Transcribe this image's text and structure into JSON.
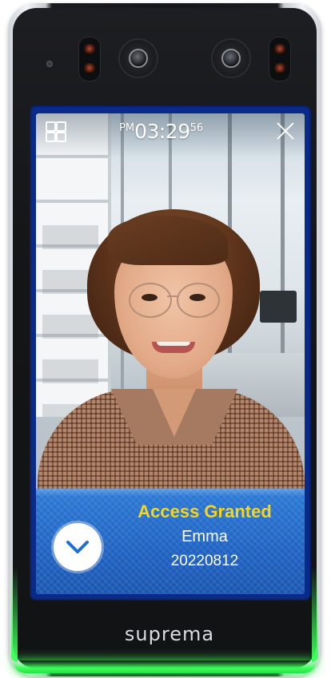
{
  "device": {
    "brand": "suprema",
    "led_color": "#3cff58",
    "frame_color": "#0a2a8a"
  },
  "status_bar": {
    "ampm": "PM",
    "time": "03:29",
    "seconds": "56",
    "menu_icon": "grid-menu-icon",
    "close_icon": "close-icon"
  },
  "result": {
    "status": "Access Granted",
    "name": "Emma",
    "user_id": "20220812",
    "status_color": "#f7d51b",
    "panel_color": "#2470cc",
    "badge_icon": "check-icon"
  }
}
